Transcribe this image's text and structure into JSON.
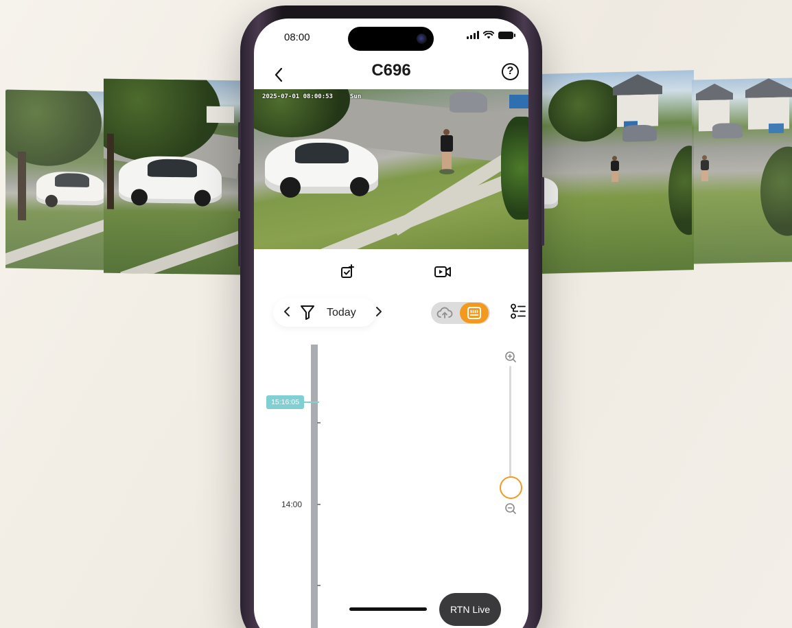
{
  "status_bar": {
    "time": "08:00"
  },
  "header": {
    "title": "C696",
    "back_icon": "chevron-left-icon",
    "help_icon": "question-circle-icon",
    "help_glyph": "?"
  },
  "video": {
    "timestamp": "2025-07-01 08:00:53",
    "weekday": "Sun"
  },
  "actions": [
    {
      "name": "snapshot-icon"
    },
    {
      "name": "record-video-icon"
    }
  ],
  "filter": {
    "prev": "‹",
    "next": "›",
    "label": "Today",
    "icon": "filter-funnel-icon"
  },
  "storage_toggle": {
    "options": [
      "cloud-icon",
      "sd-card-icon"
    ],
    "selected": "sd-card-icon"
  },
  "timeline": {
    "current_time": "15:16:05",
    "time_label": "14:00"
  },
  "zoom": {
    "level": 0.9
  },
  "rtn_live": {
    "label": "RTN Live"
  },
  "colors": {
    "accent": "#f39a1e",
    "timeline_marker": "#7fcfd3",
    "live_button": "#3a3a3c"
  }
}
